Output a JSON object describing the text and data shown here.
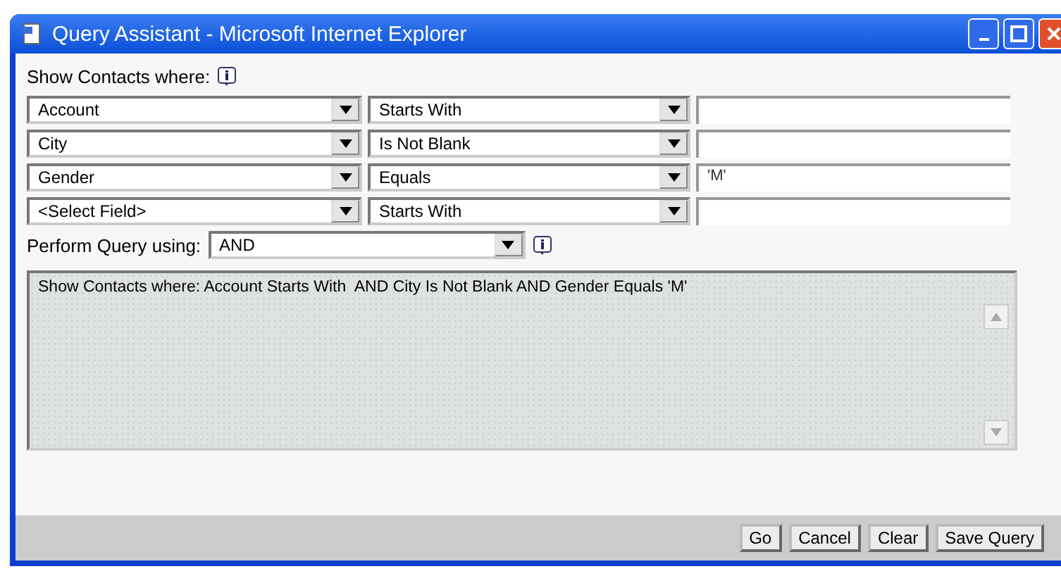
{
  "window": {
    "title": "Query Assistant - Microsoft Internet Explorer"
  },
  "heading": "Show Contacts where:",
  "conditions": [
    {
      "field": "Account",
      "operator": "Starts With"
    },
    {
      "field": "City",
      "operator": "Is Not Blank"
    },
    {
      "field": "Gender",
      "operator": "Equals",
      "value": "'M'"
    },
    {
      "field": "<Select Field>",
      "operator": "Starts With"
    }
  ],
  "perform": {
    "label": "Perform Query using:",
    "value": "AND"
  },
  "summary": "Show Contacts where: Account Starts With  AND City Is Not Blank AND Gender Equals 'M'",
  "buttons": [
    "Go",
    "Cancel",
    "Clear",
    "Save Query"
  ]
}
